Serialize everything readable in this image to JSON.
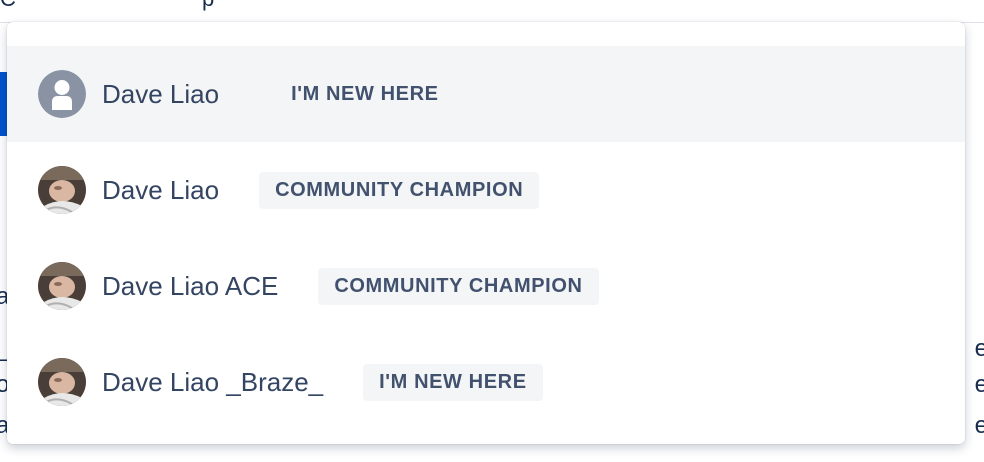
{
  "mention_dropdown": {
    "items": [
      {
        "name": "Dave Liao",
        "badge": "I'M NEW HERE",
        "avatar": "default-avatar-icon",
        "highlighted": true
      },
      {
        "name": "Dave Liao",
        "badge": "COMMUNITY CHAMPION",
        "avatar": "profile-photo",
        "highlighted": false
      },
      {
        "name": "Dave Liao ACE",
        "badge": "COMMUNITY CHAMPION",
        "avatar": "profile-photo",
        "highlighted": false
      },
      {
        "name": "Dave Liao _Braze_",
        "badge": "I'M NEW HERE",
        "avatar": "profile-photo",
        "highlighted": false
      }
    ]
  },
  "colors": {
    "highlight_bg": "#f4f5f7",
    "name_text": "#344563",
    "badge_text": "#42526e",
    "default_avatar": "#8993a4",
    "accent_blue": "#0052cc"
  }
}
